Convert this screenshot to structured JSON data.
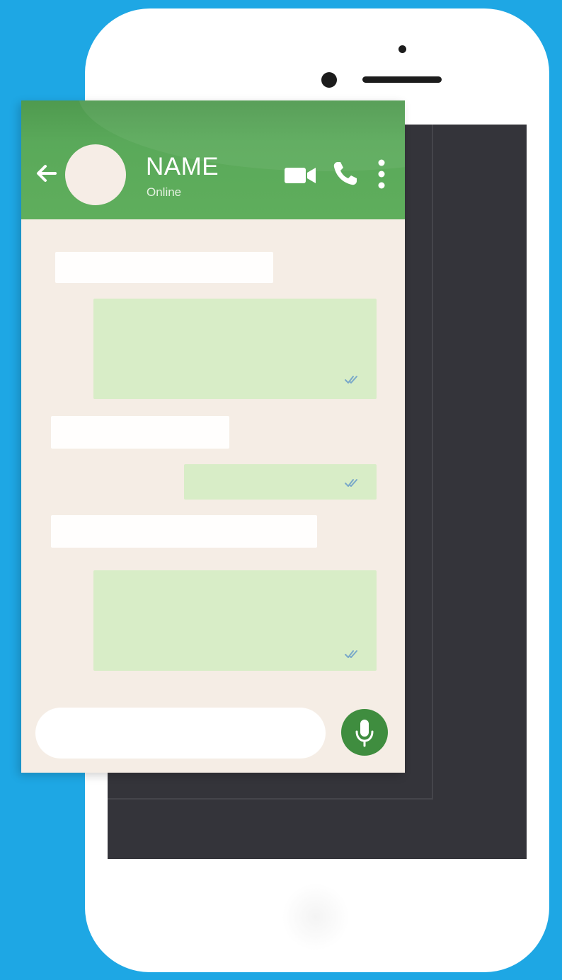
{
  "header": {
    "name": "NAME",
    "status": "Online"
  },
  "icons": {
    "back": "back-arrow-icon",
    "video": "video-camera-icon",
    "call": "phone-icon",
    "more": "more-vertical-icon",
    "mic": "microphone-icon",
    "read_receipt": "double-check-icon"
  },
  "colors": {
    "background": "#1ea7e4",
    "header": "#5aa95a",
    "chat_background": "#f5ede5",
    "outgoing_bubble": "#d8edc7",
    "incoming_bubble": "#ffffff",
    "mic_button": "#3f8d3f",
    "screen_dark": "#34343a"
  }
}
